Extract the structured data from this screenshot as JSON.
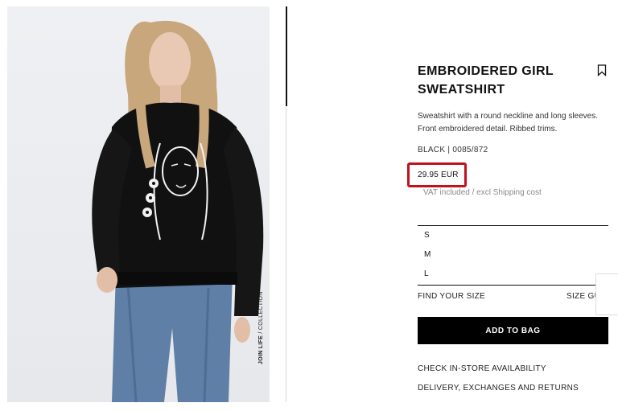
{
  "product": {
    "title": "EMBROIDERED GIRL SWEATSHIRT",
    "description": "Sweatshirt with a round neckline and long sleeves. Front embroidered detail. Ribbed trims.",
    "color_ref": "BLACK | 0085/872",
    "price": "29.95 EUR",
    "vat_note": "VAT included / excl Shipping cost"
  },
  "photo": {
    "tag_bold": "JOIN LIFE",
    "tag_rest": " / COLLECTION"
  },
  "sizes": [
    "S",
    "M",
    "L"
  ],
  "links": {
    "find_size": "FIND YOUR SIZE",
    "size_guide": "SIZE GU",
    "add_to_bag": "ADD TO BAG",
    "check_store": "CHECK IN-STORE AVAILABILITY",
    "delivery": "DELIVERY, EXCHANGES AND RETURNS"
  },
  "icons": {
    "bookmark": "bookmark-icon"
  },
  "colors": {
    "accent": "#000000",
    "highlight": "#c0111f",
    "muted": "#8a8a8a"
  }
}
